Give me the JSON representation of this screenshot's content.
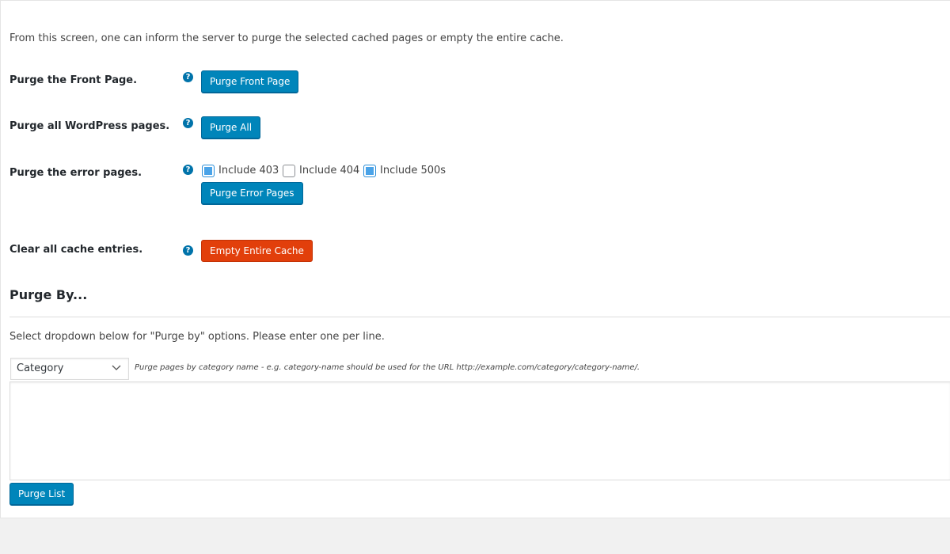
{
  "intro": "From this screen, one can inform the server to purge the selected cached pages or empty the entire cache.",
  "rows": {
    "front": {
      "label": "Purge the Front Page.",
      "button": "Purge Front Page"
    },
    "all": {
      "label": "Purge all WordPress pages.",
      "button": "Purge All"
    },
    "errors": {
      "label": "Purge the error pages.",
      "button": "Purge Error Pages",
      "options": [
        {
          "label": "Include 403",
          "checked": true
        },
        {
          "label": "Include 404",
          "checked": false
        },
        {
          "label": "Include 500s",
          "checked": true
        }
      ]
    },
    "empty": {
      "label": "Clear all cache entries.",
      "button": "Empty Entire Cache"
    }
  },
  "help_icon_glyph": "?",
  "purge_by": {
    "heading": "Purge By...",
    "description": "Select dropdown below for \"Purge by\" options. Please enter one per line.",
    "select_value": "Category",
    "hint": "Purge pages by category name - e.g. category-name should be used for the URL http://example.com/category/category-name/.",
    "textarea_value": "",
    "button": "Purge List"
  },
  "colors": {
    "primary_button": "#0085ba",
    "danger_button": "#e23f0b",
    "help_icon": "#0073aa"
  }
}
